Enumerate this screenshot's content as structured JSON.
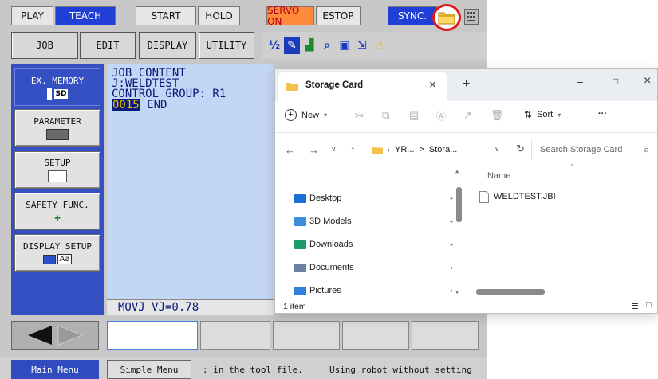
{
  "pendant": {
    "top_bar": {
      "play": "PLAY",
      "teach": "TEACH",
      "start": "START",
      "hold": "HOLD",
      "servo_on": "SERVO ON",
      "estop": "ESTOP",
      "sync": "SYNC."
    },
    "menu_bar": {
      "job": "JOB",
      "edit": "EDIT",
      "display": "DISPLAY",
      "utility": "UTILITY"
    },
    "sidebar": {
      "ex_memory": "EX. MEMORY",
      "ex_memory_icon_label": "SD",
      "parameter": "PARAMETER",
      "setup": "SETUP",
      "safety_func": "SAFETY FUNC.",
      "display_setup": "DISPLAY SETUP",
      "display_setup_icon_label": "Aa"
    },
    "job": {
      "line1": "JOB CONTENT",
      "line2": "J:WELDTEST",
      "line3": "CONTROL GROUP: R1",
      "line_number": "0015",
      "line_end": "END",
      "input_line": "MOVJ VJ=0.78"
    },
    "status_bar": {
      "main_menu": "Main Menu",
      "simple_menu": "Simple Menu",
      "message": ": in the tool file.     Using robot without setting"
    }
  },
  "explorer": {
    "tab_title": "Storage Card",
    "new_tab": "+",
    "close_tab": "×",
    "minimize": "–",
    "maximize": "□",
    "close": "×",
    "toolbar": {
      "new": "New",
      "sort": "Sort",
      "more": "···"
    },
    "address": {
      "part1": "YR...",
      "sep": ">",
      "part2": "Stora..."
    },
    "search_placeholder": "Search Storage Card",
    "column_name": "Name",
    "nav_items": [
      {
        "label": "Desktop",
        "color": "#1d6fd6"
      },
      {
        "label": "3D Models",
        "color": "#3a8fd8"
      },
      {
        "label": "Downloads",
        "color": "#1f9a6b"
      },
      {
        "label": "Documents",
        "color": "#6d7fa3"
      },
      {
        "label": "Pictures",
        "color": "#2f7fe0"
      }
    ],
    "file": "WELDTEST.JBI",
    "status": "1 item"
  }
}
